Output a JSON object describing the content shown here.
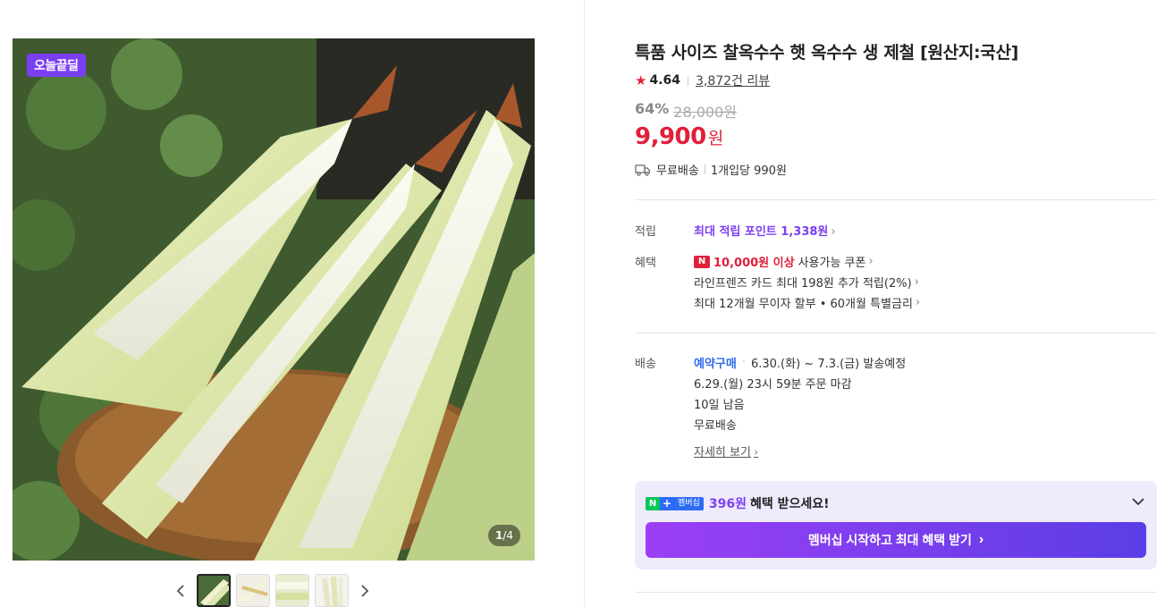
{
  "gallery": {
    "deal_badge": "오늘끝딜",
    "counter_current": "1",
    "counter_total": "/4",
    "prev_icon": "chevron-left-icon",
    "next_icon": "chevron-right-icon"
  },
  "product": {
    "title": "특품 사이즈 찰옥수수 햇 옥수수 생 제철 [원산지:국산]",
    "rating": "4.64",
    "review_count": "3,872건 리뷰",
    "discount_rate": "64%",
    "original_price": "28,000원",
    "price": "9,900",
    "price_unit": "원",
    "shipping": "무료배송",
    "unit_price": "1개입당 990원"
  },
  "points": {
    "label": "적립",
    "text": "최대 적립 포인트 1,338원"
  },
  "benefits": {
    "label": "혜택",
    "coupon_badge": "N",
    "coupon_strong": "10,000원 이상",
    "coupon_text": "사용가능 쿠폰",
    "card_text": "라인프렌즈 카드 최대 198원 추가 적립(2%)",
    "installment_text": "최대 12개월 무이자 할부 • 60개월 특별금리"
  },
  "delivery": {
    "label": "배송",
    "pre_order": "예약구매",
    "schedule": "6.30.(화) ~ 7.3.(금) 발송예정",
    "deadline": "6.29.(월) 23시 59분 주문 마감",
    "remaining": "10일 남음",
    "fee": "무료배송",
    "detail_link": "자세히 보기"
  },
  "membership": {
    "n_badge": "N",
    "plus_badge": "+",
    "tag": "멤버십",
    "amount": "396원",
    "text": "혜택 받으세요!",
    "button_label": "멤버십 시작하고 최대 혜택 받기"
  },
  "colors": {
    "accent_purple": "#7b3ff2",
    "price_red": "#e0203b",
    "pre_order_blue": "#2f6bea"
  }
}
